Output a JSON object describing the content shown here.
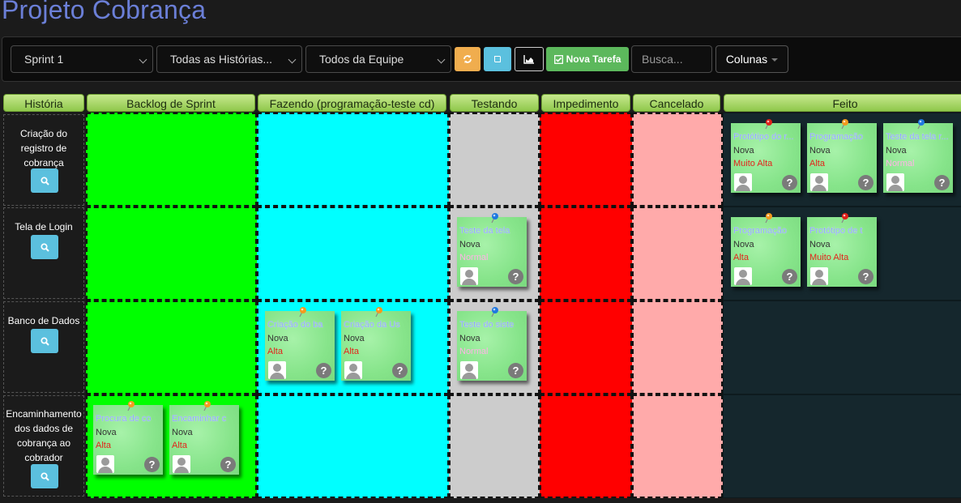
{
  "title": "Projeto Cobrança",
  "toolbar": {
    "sprint": "Sprint 1",
    "stories": "Todas as Histórias...",
    "team": "Todos da Equipe",
    "new_task": "Nova Tarefa",
    "search_placeholder": "Busca...",
    "columns": "Colunas"
  },
  "columns": [
    "História",
    "Backlog de Sprint",
    "Fazendo (programação-teste cd)",
    "Testando",
    "Impedimento",
    "Cancelado",
    "Feito"
  ],
  "stories": [
    "Criação do registro de cobrança",
    "Tela de Login",
    "Banco de Dados",
    "Encaminhamento dos dados de cobrança ao cobrador"
  ],
  "colors": {
    "backlog": "#00ff00",
    "doing": "#00ffff",
    "testing": "#cccccc",
    "impediment": "#ff0000",
    "cancelled": "#ffaaaa",
    "done": "#15272d",
    "priority_high": "#e3241b",
    "priority_normal": "#ffb3e6"
  },
  "cards": [
    {
      "title": "Protótipo do r...",
      "status": "Nova",
      "priority": "Muito Alta",
      "pin": "red"
    },
    {
      "title": "Programação",
      "status": "Nova",
      "priority": "Alta",
      "pin": "orange"
    },
    {
      "title": "Teste da tela r...",
      "status": "Nova",
      "priority": "Normal",
      "pin": "blue"
    },
    {
      "title": "Teste da tela",
      "status": "Nova",
      "priority": "Normal",
      "pin": "blue"
    },
    {
      "title": "Programação",
      "status": "Nova",
      "priority": "Alta",
      "pin": "orange"
    },
    {
      "title": "Protótipo de t",
      "status": "Nova",
      "priority": "Muito Alta",
      "pin": "red"
    },
    {
      "title": "Criação do ba",
      "status": "Nova",
      "priority": "Alta",
      "pin": "orange"
    },
    {
      "title": "Criação da Us",
      "status": "Nova",
      "priority": "Alta",
      "pin": "orange"
    },
    {
      "title": "Teste do siste",
      "status": "Nova",
      "priority": "Normal",
      "pin": "blue"
    },
    {
      "title": "Procura de co",
      "status": "Nova",
      "priority": "Alta",
      "pin": "orange"
    },
    {
      "title": "Encaminhar c",
      "status": "Nova",
      "priority": "Alta",
      "pin": "orange"
    }
  ]
}
